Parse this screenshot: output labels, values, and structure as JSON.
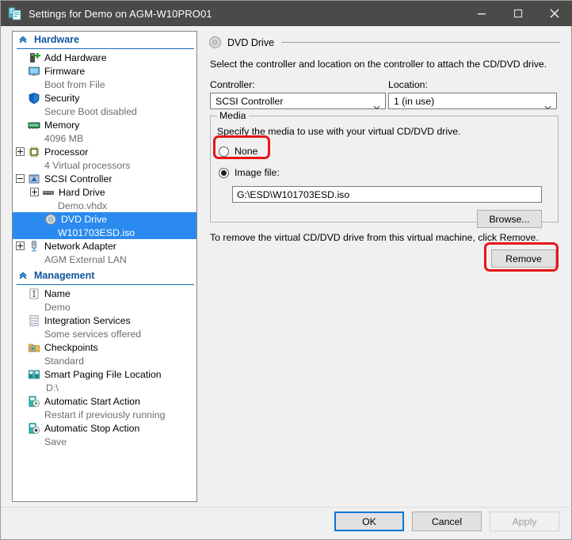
{
  "window": {
    "title": "Settings for Demo on AGM-W10PRO01",
    "icon": "settings-vm-icon",
    "minimize_label": "Minimize",
    "maximize_label": "Maximize",
    "close_label": "Close",
    "titlebar_color": "#4c4a48"
  },
  "sidebar": {
    "groups": [
      {
        "name": "Hardware",
        "items": [
          {
            "label": "Add Hardware",
            "sub": "",
            "icon": "add-hardware-icon",
            "expander": "none",
            "indent": 1,
            "selected": false
          },
          {
            "label": "Firmware",
            "sub": "Boot from File",
            "icon": "firmware-icon",
            "expander": "none",
            "indent": 1,
            "selected": false
          },
          {
            "label": "Security",
            "sub": "Secure Boot disabled",
            "icon": "security-shield-icon",
            "expander": "none",
            "indent": 1,
            "selected": false
          },
          {
            "label": "Memory",
            "sub": "4096 MB",
            "icon": "memory-icon",
            "expander": "none",
            "indent": 1,
            "selected": false
          },
          {
            "label": "Processor",
            "sub": "4 Virtual processors",
            "icon": "processor-icon",
            "expander": "plus",
            "indent": 0,
            "selected": false
          },
          {
            "label": "SCSI Controller",
            "sub": "",
            "icon": "scsi-controller-icon",
            "expander": "minus",
            "indent": 0,
            "selected": false
          },
          {
            "label": "Hard Drive",
            "sub": "Demo.vhdx",
            "icon": "hard-drive-icon",
            "expander": "plus",
            "indent": 1,
            "selected": false
          },
          {
            "label": "DVD Drive",
            "sub": "W101703ESD.iso",
            "icon": "dvd-drive-icon",
            "expander": "none",
            "indent": 2,
            "selected": true
          },
          {
            "label": "Network Adapter",
            "sub": "AGM External LAN",
            "icon": "network-adapter-icon",
            "expander": "plus",
            "indent": 0,
            "selected": false
          }
        ]
      },
      {
        "name": "Management",
        "items": [
          {
            "label": "Name",
            "sub": "Demo",
            "icon": "name-icon",
            "expander": "none",
            "indent": 1,
            "selected": false
          },
          {
            "label": "Integration Services",
            "sub": "Some services offered",
            "icon": "integration-services-icon",
            "expander": "none",
            "indent": 1,
            "selected": false
          },
          {
            "label": "Checkpoints",
            "sub": "Standard",
            "icon": "checkpoints-icon",
            "expander": "none",
            "indent": 1,
            "selected": false
          },
          {
            "label": "Smart Paging File Location",
            "sub": "D:\\",
            "icon": "smart-paging-icon",
            "expander": "none",
            "indent": 1,
            "selected": false
          },
          {
            "label": "Automatic Start Action",
            "sub": "Restart if previously running",
            "icon": "auto-start-icon",
            "expander": "none",
            "indent": 1,
            "selected": false
          },
          {
            "label": "Automatic Stop Action",
            "sub": "Save",
            "icon": "auto-stop-icon",
            "expander": "none",
            "indent": 1,
            "selected": false
          }
        ]
      }
    ]
  },
  "main": {
    "header": "DVD Drive",
    "header_icon": "dvd-disc-icon",
    "description": "Select the controller and location on the controller to attach the CD/DVD drive.",
    "controller": {
      "label": "Controller:",
      "value": "SCSI Controller"
    },
    "location": {
      "label": "Location:",
      "value": "1 (in use)"
    },
    "media": {
      "legend": "Media",
      "description": "Specify the media to use with your virtual CD/DVD drive.",
      "none_label": "None",
      "none_selected": false,
      "image_label": "Image file:",
      "image_selected": true,
      "image_path": "G:\\ESD\\W101703ESD.iso",
      "browse_label": "Browse..."
    },
    "remove_description": "To remove the virtual CD/DVD drive from this virtual machine, click Remove.",
    "remove_label": "Remove"
  },
  "footer": {
    "ok_label": "OK",
    "cancel_label": "Cancel",
    "apply_label": "Apply",
    "apply_disabled": true
  },
  "annotations": {
    "color": "#e81515",
    "highlight_none": "none-radio-highlight",
    "highlight_remove": "remove-button-highlight"
  }
}
